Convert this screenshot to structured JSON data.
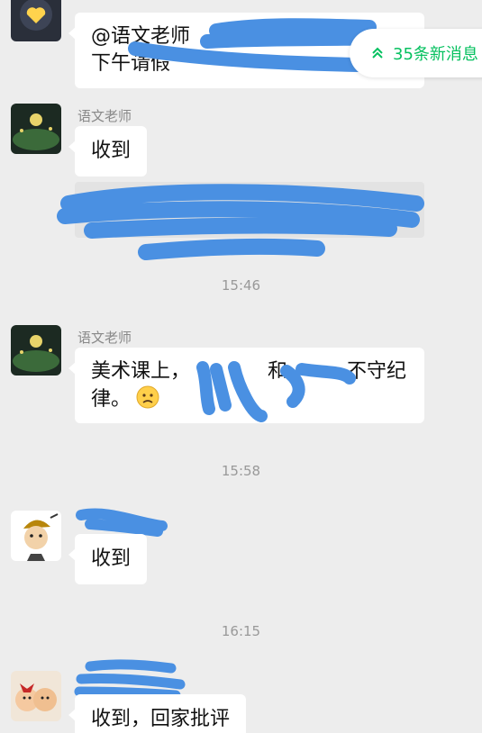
{
  "new_messages": {
    "label": "35条新消息",
    "icon": "double-chevron-up-icon",
    "color": "#07c160"
  },
  "messages": [
    {
      "sender": "",
      "lines": [
        "@语文老师 ",
        "下午请假"
      ]
    },
    {
      "sender": "语文老师",
      "text": "收到"
    },
    {
      "quote": ""
    },
    {
      "time": "15:46"
    },
    {
      "sender": "语文老师",
      "lines": [
        "美术课上，",
        "律。"
      ],
      "mid": "和",
      "tail": "不守纪"
    },
    {
      "time": "15:58"
    },
    {
      "sender": "",
      "text": "收到"
    },
    {
      "time": "16:15"
    },
    {
      "sender": "",
      "text": "收到，回家批评"
    }
  ],
  "colors": {
    "bubble": "#ffffff",
    "background": "#ededed",
    "redaction": "#4a90e2"
  }
}
